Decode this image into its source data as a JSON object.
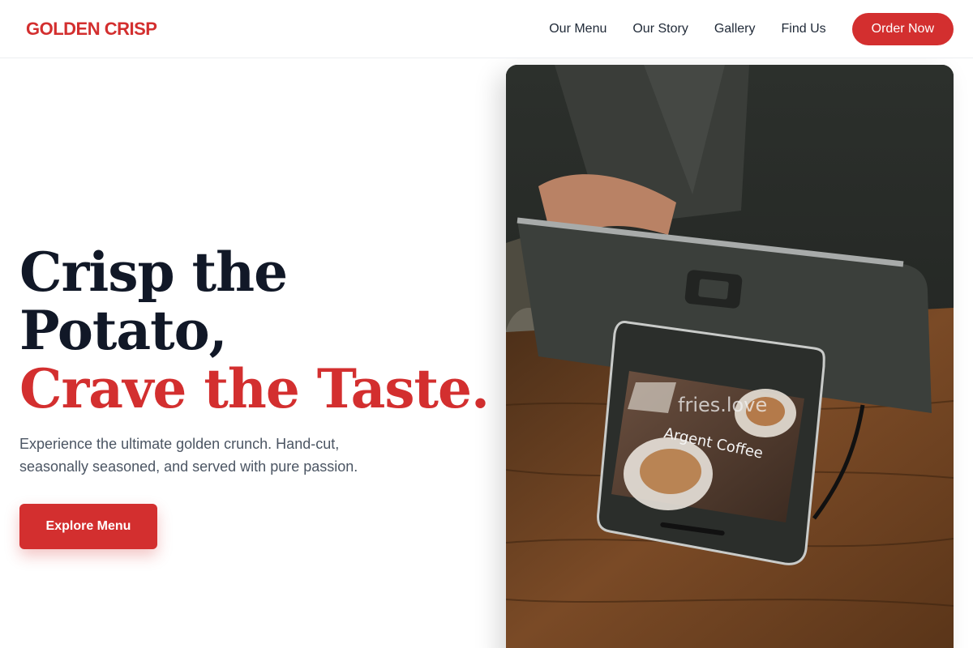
{
  "nav": {
    "logo": "GOLDEN CRISP",
    "links": [
      "Our Menu",
      "Our Story",
      "Gallery",
      "Find Us"
    ],
    "cta": "Order Now"
  },
  "hero": {
    "headline_line1": "Crisp the",
    "headline_line2": "Potato,",
    "headline_accent": "Crave the Taste.",
    "subtext": "Experience the ultimate golden crunch. Hand-cut, seasonally seasoned, and served with pure passion.",
    "button": "Explore Menu"
  },
  "photo": {
    "overlay_text": "fries.love",
    "screen_text": "Argent Coffee"
  },
  "colors": {
    "accent": "#d32f2f",
    "heading": "#111827",
    "body": "#4b5563"
  }
}
